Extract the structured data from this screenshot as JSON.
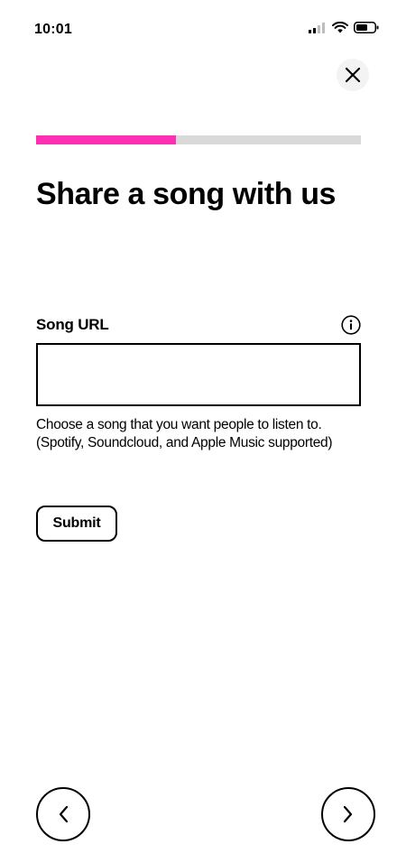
{
  "status_bar": {
    "time": "10:01",
    "icons": [
      "cellular-signal-icon",
      "wifi-icon",
      "battery-icon"
    ]
  },
  "header": {
    "close_icon": "close-icon"
  },
  "progress": {
    "value": 0.43,
    "fill_color": "#ff2fb3",
    "track_color": "#d9d9d9"
  },
  "main": {
    "title": "Share a song with us",
    "song_url": {
      "label": "Song URL",
      "info_icon": "info-icon",
      "value": "",
      "placeholder": ""
    },
    "helper_text_line1": "Choose a song that you want people to listen to.",
    "helper_text_line2": "(Spotify, Soundcloud, and Apple Music supported)",
    "submit_label": "Submit"
  },
  "footer": {
    "prev_icon": "chevron-left-icon",
    "next_icon": "chevron-right-icon"
  }
}
